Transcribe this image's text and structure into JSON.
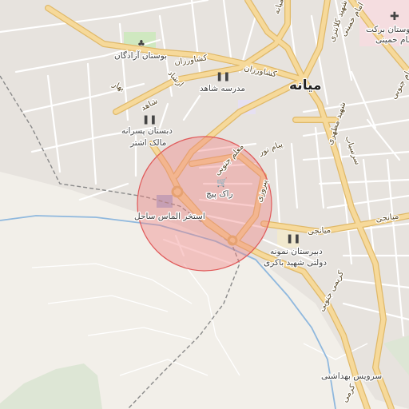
{
  "map": {
    "city_label": "میانه",
    "search_circle": {
      "fill": "#f08080",
      "stroke": "#e05858"
    },
    "roads": {
      "keshavarzan": "کشاورزان",
      "keshavarzan2": "کشاورزان",
      "shahed": "شاهد",
      "ershad": "ارشاد",
      "bahar": "بهار",
      "moallem_jonubi": "معلم جنوبی",
      "payam_nur": "پیام نور",
      "piruzi": "پیروزی",
      "shahid_motahari": "شهید مطهری",
      "sarasiab": "سرسیاب",
      "payam_jonubi": "پیام جنوبی",
      "miyanaji": "میانجی",
      "miyanaji2": "میانجی",
      "karimi_jonubi": "کریمی جنوبی",
      "miyaneh_road": "میانه",
      "emam_khomeini": "امام خمینی",
      "shahid_kalantari": "شهید کلانتری",
      "karimi": "کرمی"
    },
    "pois": {
      "park_azadegan": "بوستان آزادگان",
      "school_shahed": "مدرسه شاهد",
      "school_malek_ashtar_1": "دبستان پسرانه",
      "school_malek_ashtar_2": "مالک اشتر",
      "rak_pich": "راک پیچ",
      "pool_almas_sahel": "استخر الماس ساحل",
      "school_nemuneh_1": "دبیرستان نمونه",
      "school_nemuneh_2": "دولتی شهید باکری",
      "health_service": "سرویس بهداشتی",
      "park_barakat": "بوستان برکت",
      "hospital_khomeini": "امام خمینی"
    },
    "colors": {
      "background": "#f2efe9",
      "residential": "#e7e3de",
      "street": "#ffffff",
      "major_road": "#f6d99a",
      "major_road_casing": "#e0b969",
      "river": "#8fb8de",
      "railway": "#8a8a8a",
      "park": "#cfe8c0",
      "school_area": "#f1e9ce",
      "hospital_area": "#f5dde0"
    }
  }
}
